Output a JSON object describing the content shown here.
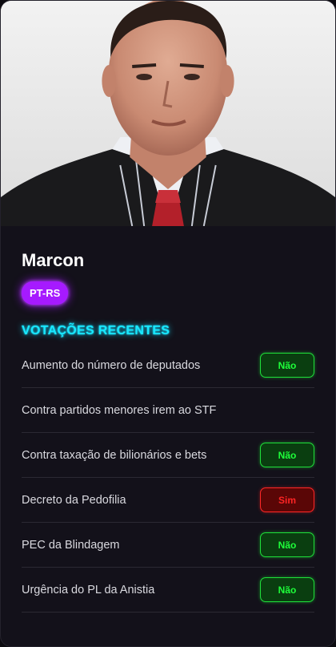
{
  "profile": {
    "name": "Marcon",
    "party": "PT-RS"
  },
  "section_title": "VOTAÇÕES RECENTES",
  "votes": [
    {
      "title": "Aumento do número de deputados",
      "vote": "Não",
      "type": "nao"
    },
    {
      "title": "Contra partidos menores irem ao STF",
      "vote": "",
      "type": "empty"
    },
    {
      "title": "Contra taxação de bilionários e bets",
      "vote": "Não",
      "type": "nao"
    },
    {
      "title": "Decreto da Pedofilia",
      "vote": "Sim",
      "type": "sim"
    },
    {
      "title": "PEC da Blindagem",
      "vote": "Não",
      "type": "nao"
    },
    {
      "title": "Urgência do PL da Anistia",
      "vote": "Não",
      "type": "nao"
    }
  ],
  "colors": {
    "accent_cyan": "#19e8ff",
    "party_purple": "#a61aff",
    "vote_no_green": "#1eff3a",
    "vote_yes_red": "#ff2424",
    "card_background": "#13111a"
  }
}
